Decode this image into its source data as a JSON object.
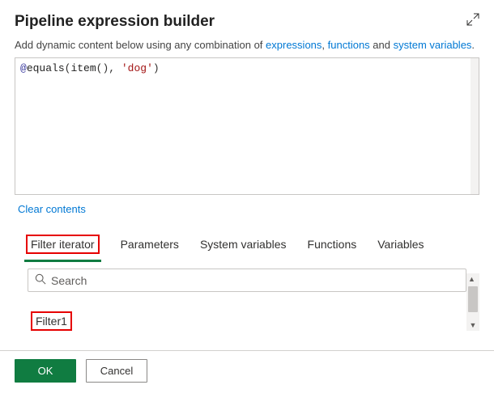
{
  "header": {
    "title": "Pipeline expression builder"
  },
  "subtitle": {
    "prefix": "Add dynamic content below using any combination of ",
    "link1": "expressions",
    "sep1": ", ",
    "link2": "functions",
    "sep2": " and ",
    "link3": "system variables",
    "suffix": "."
  },
  "editor": {
    "at": "@",
    "fn": "equals",
    "open": "(",
    "itemfn": "item",
    "item_parens": "()",
    "comma": ", ",
    "str": "'dog'",
    "close": ")"
  },
  "clear_label": "Clear contents",
  "tabs": {
    "filter_iterator": "Filter iterator",
    "parameters": "Parameters",
    "system_variables": "System variables",
    "functions": "Functions",
    "variables": "Variables"
  },
  "search": {
    "placeholder": "Search"
  },
  "items": {
    "filter1": "Filter1"
  },
  "footer": {
    "ok": "OK",
    "cancel": "Cancel"
  }
}
